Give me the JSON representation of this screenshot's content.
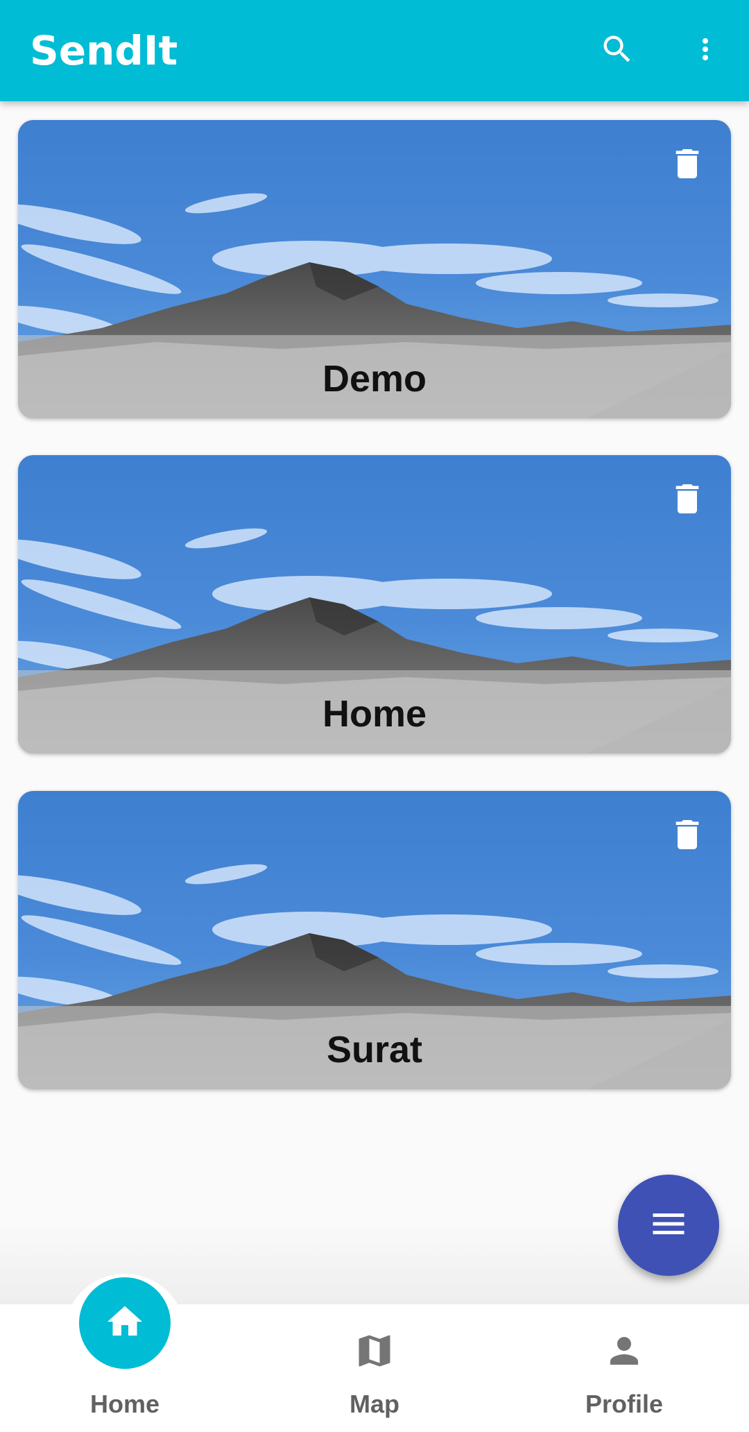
{
  "app": {
    "title": "SendIt",
    "accent": "#00bcd4",
    "fab_color": "#3f51b5"
  },
  "toolbar": {
    "search_icon": "search-icon",
    "more_icon": "more-vert-icon"
  },
  "cards": [
    {
      "label": "Demo",
      "action_icon": "delete-icon"
    },
    {
      "label": "Home",
      "action_icon": "delete-icon"
    },
    {
      "label": "Surat",
      "action_icon": "delete-icon"
    }
  ],
  "fab": {
    "icon": "menu-icon"
  },
  "bottom_nav": {
    "items": [
      {
        "label": "Home",
        "icon": "home-icon",
        "selected": true
      },
      {
        "label": "Map",
        "icon": "map-icon",
        "selected": false
      },
      {
        "label": "Profile",
        "icon": "person-icon",
        "selected": false
      }
    ]
  }
}
